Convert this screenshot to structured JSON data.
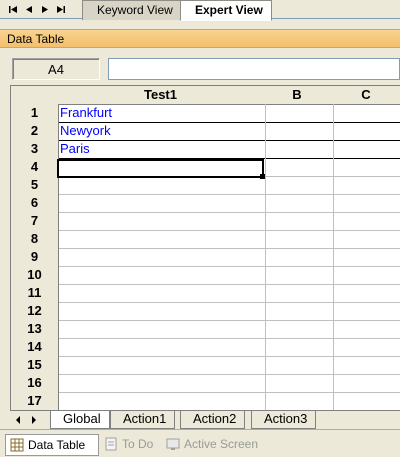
{
  "top_tabs": [
    {
      "label": "Keyword View",
      "active": false
    },
    {
      "label": "Expert View",
      "active": true
    }
  ],
  "panel_title": "Data Table",
  "formula_bar": {
    "cell_ref": "A4",
    "value": ""
  },
  "grid": {
    "columns": [
      "Test1",
      "B",
      "C"
    ],
    "rows": [
      "1",
      "2",
      "3",
      "4",
      "5",
      "6",
      "7",
      "8",
      "9",
      "10",
      "11",
      "12",
      "13",
      "14",
      "15",
      "16",
      "17"
    ],
    "cells": {
      "A1": "Frankfurt",
      "A2": "Newyork",
      "A3": "Paris"
    },
    "selected_cell": "A4"
  },
  "sheet_tabs": [
    {
      "label": "Global",
      "active": true
    },
    {
      "label": "Action1",
      "active": false
    },
    {
      "label": "Action2",
      "active": false
    },
    {
      "label": "Action3",
      "active": false
    }
  ],
  "bottom_tabs": [
    {
      "label": "Data Table",
      "icon": "table-icon",
      "enabled": true
    },
    {
      "label": "To Do",
      "icon": "todo-icon",
      "enabled": false
    },
    {
      "label": "Active Screen",
      "icon": "active-screen-icon",
      "enabled": false
    }
  ]
}
